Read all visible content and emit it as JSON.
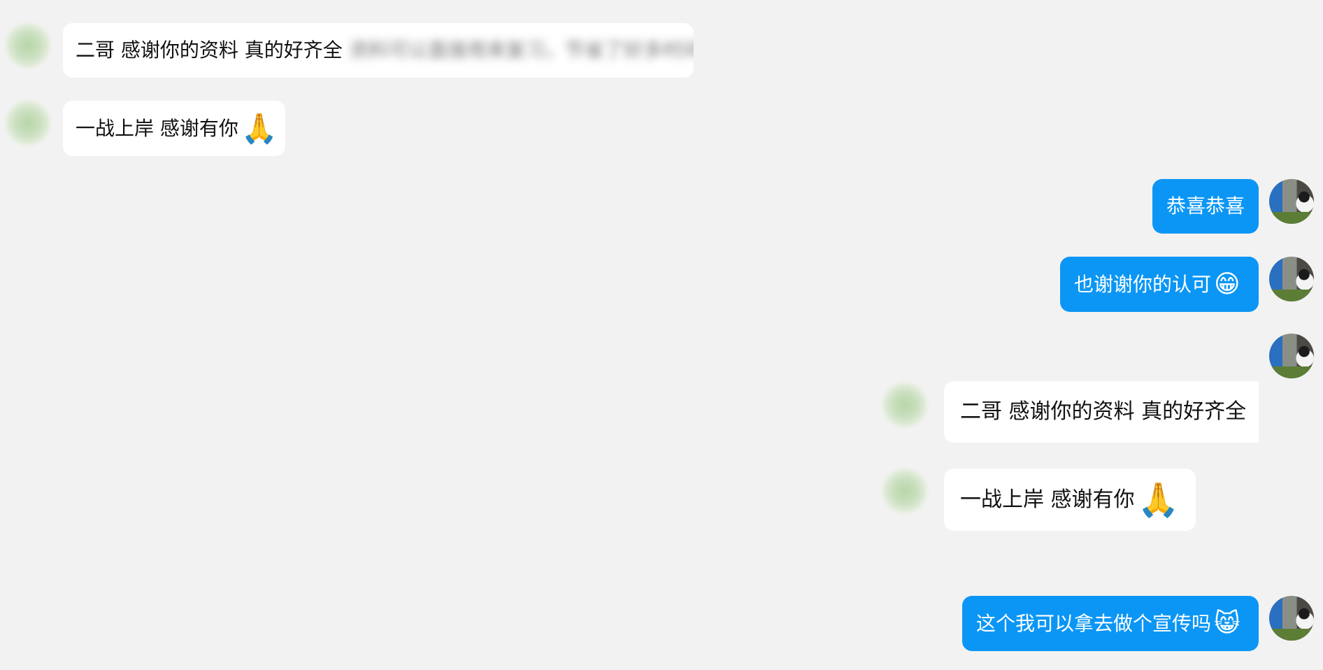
{
  "messages": [
    {
      "side": "in",
      "text": "二哥 感谢你的资料 真的好齐全",
      "hidden": "资料可以直接用来复习，节省了好多时间"
    },
    {
      "side": "in",
      "text": "一战上岸 感谢有你",
      "emoji": "🙏"
    },
    {
      "side": "out",
      "text": "恭喜恭喜"
    },
    {
      "side": "out",
      "text": "也谢谢你的认可",
      "emoji": "😁"
    },
    {
      "side": "quote",
      "text": "二哥 感谢你的资料 真的好齐全"
    },
    {
      "side": "quote",
      "text": "一战上岸 感谢有你",
      "emoji": "🙏"
    },
    {
      "side": "out",
      "text": "这个我可以拿去做个宣传吗",
      "emoji": "😸"
    }
  ],
  "colors": {
    "background": "#f2f2f2",
    "bubble_in": "#ffffff",
    "bubble_out": "#0b96f5"
  },
  "icons": {
    "pray": "pray-emoji-icon",
    "grin": "grinning-face-icon",
    "cat": "cat-emoji-icon"
  }
}
